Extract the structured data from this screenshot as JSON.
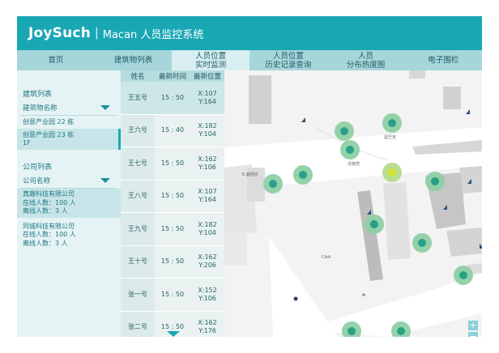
{
  "header": {
    "brand": "JoySuch",
    "separator": "|",
    "subtitle": "Macan 人员监控系统"
  },
  "nav": {
    "tabs": [
      {
        "label": "首页"
      },
      {
        "label": "建筑物列表"
      },
      {
        "label": "人员位置\n实时监测"
      },
      {
        "label": "人员位置\n历史记录查询"
      },
      {
        "label": "人员\n分布热度图"
      },
      {
        "label": "电子围栏"
      }
    ]
  },
  "sidebar": {
    "building_title": "建筑列表",
    "building_select": "建筑物名称",
    "buildings": [
      {
        "label": "创意产业园 22 栋"
      },
      {
        "label": "创意产业园 23 栋"
      },
      {
        "label": "1F"
      }
    ],
    "company_title": "公司列表",
    "company_select": "公司名称",
    "companies": [
      {
        "name": "真趣科技有限公司",
        "online": "在线人数：100 人",
        "offline": "离线人数：3 人"
      },
      {
        "name": "同城科技有限公司",
        "online": "在线人数：100 人",
        "offline": "离线人数：3 人"
      }
    ]
  },
  "table": {
    "headers": [
      "姓名",
      "最新时间",
      "最新位置"
    ],
    "rows": [
      {
        "name": "王五号",
        "time": "15 : 50",
        "x": "X:107",
        "y": "Y:164"
      },
      {
        "name": "王六号",
        "time": "15 : 40",
        "x": "X:182",
        "y": "Y:104"
      },
      {
        "name": "王七号",
        "time": "15 : 50",
        "x": "X:162",
        "y": "Y:106"
      },
      {
        "name": "王八号",
        "time": "15 : 50",
        "x": "X:107",
        "y": "Y:164"
      },
      {
        "name": "王九号",
        "time": "15 : 50",
        "x": "X:182",
        "y": "Y:104"
      },
      {
        "name": "王十号",
        "time": "15 : 50",
        "x": "X:162",
        "y": "Y:206"
      },
      {
        "name": "张一号",
        "time": "15 : 50",
        "x": "X:152",
        "y": "Y:106"
      },
      {
        "name": "张二号",
        "time": "15 : 50",
        "x": "X:162",
        "y": "Y:176"
      }
    ]
  },
  "map": {
    "labels": [
      "星巴克",
      "沃施霓",
      "E.面团坊",
      "CibA"
    ],
    "zoom_in": "+",
    "zoom_out": "−"
  },
  "colors": {
    "primary": "#1aa7b4",
    "nav_bg": "#a6d6da",
    "sidebar_bg": "#e6f3f4",
    "pin_outer": "#8fd0a5",
    "pin_inner": "#1f9c83",
    "pin_selected": "#d8e229"
  },
  "icons": [
    "caret-down-icon",
    "location-pin-icon",
    "zoom-in-icon",
    "zoom-out-icon",
    "info-icon"
  ]
}
